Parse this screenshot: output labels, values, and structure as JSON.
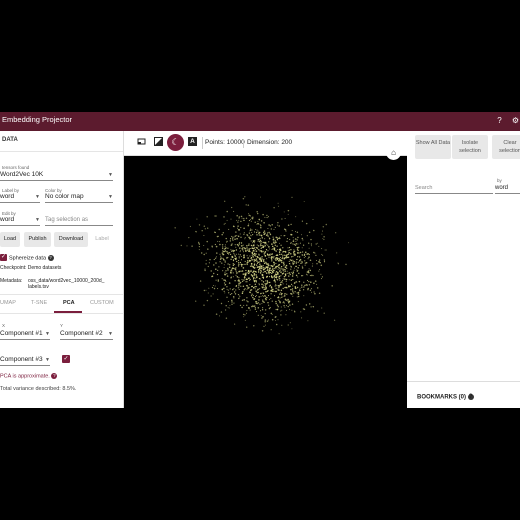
{
  "titlebar": {
    "title": "Embedding Projector",
    "help_icon": "?",
    "settings_icon": "⚙"
  },
  "data_panel": {
    "section_title": "DATA",
    "tensors_label": "tensors found",
    "tensors_value": "Word2Vec 10K",
    "label_by_label": "Label by",
    "label_by_value": "word",
    "color_by_label": "Color by",
    "color_by_value": "No color map",
    "edit_by_label": "Edit by",
    "edit_by_value": "word",
    "tag_placeholder": "Tag selection as",
    "buttons": {
      "load": "Load",
      "publish": "Publish",
      "download": "Download",
      "label": "Label"
    },
    "sphereize_label": "Sphereize data",
    "checkpoint_label": "Checkpoint:",
    "checkpoint_value": "Demo datasets",
    "metadata_label": "Metadata:",
    "metadata_value_1": "oss_data/word2vec_10000_200d_",
    "metadata_value_2": "labels.tsv"
  },
  "projection_tabs": [
    "UMAP",
    "T-SNE",
    "PCA",
    "CUSTOM"
  ],
  "pca": {
    "x_label": "X",
    "y_label": "Y",
    "x_value": "Component #1",
    "y_value": "Component #2",
    "z_value": "Component #3",
    "approx_text": "PCA is approximate.",
    "variance_text": "Total variance described: 8.5%."
  },
  "toolbar": {
    "points": "Points: 10000",
    "dimension": "Dimension: 200",
    "label_icon": "A"
  },
  "inspector": {
    "show_all": "Show All Data",
    "isolate": "Isolate selection",
    "clear": "Clear selection",
    "search_placeholder": "Search",
    "by_label": "by",
    "by_value": "word",
    "bookmarks": "BOOKMARKS (0)"
  },
  "colors": {
    "brand": "#5c1b2e",
    "accent": "#7b1e3d",
    "points": "#d8d98a"
  }
}
